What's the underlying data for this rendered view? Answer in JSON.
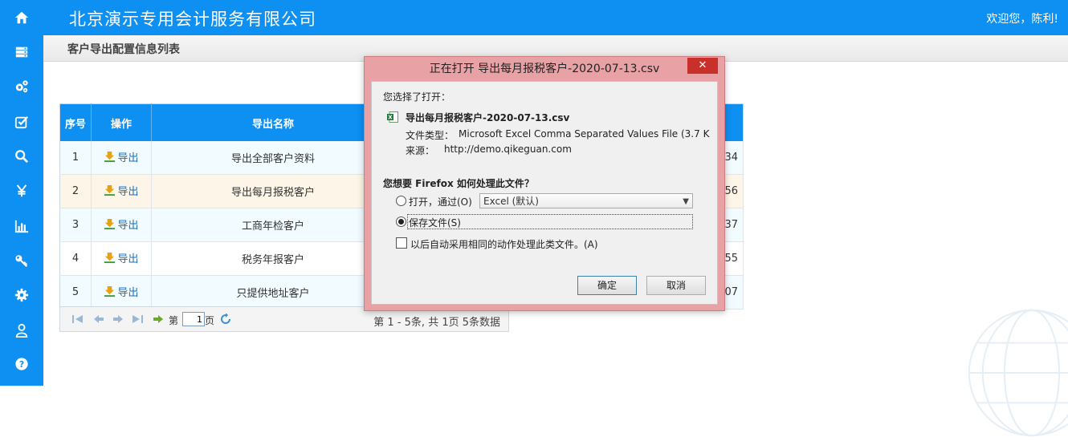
{
  "app": {
    "company_name": "北京演示专用会计服务有限公司",
    "welcome": "欢迎您，陈利!"
  },
  "sidebar": {
    "items": [
      {
        "icon": "home-icon"
      },
      {
        "icon": "server-icon"
      },
      {
        "icon": "gears-icon"
      },
      {
        "icon": "checkbox-icon"
      },
      {
        "icon": "search-icon"
      },
      {
        "icon": "yen-icon"
      },
      {
        "icon": "bar-chart-icon"
      },
      {
        "icon": "key-icon"
      },
      {
        "icon": "gear-icon"
      },
      {
        "icon": "user-icon"
      },
      {
        "icon": "help-icon"
      }
    ]
  },
  "page": {
    "title": "客户导出配置信息列表"
  },
  "table": {
    "headers": [
      "序号",
      "操作",
      "导出名称"
    ],
    "action_label": "导出",
    "rows": [
      {
        "no": "1",
        "name": "导出全部客户资料",
        "time_tail": ":34"
      },
      {
        "no": "2",
        "name": "导出每月报税客户",
        "time_tail": ":56"
      },
      {
        "no": "3",
        "name": "工商年检客户",
        "time_tail": ":37"
      },
      {
        "no": "4",
        "name": "税务年报客户",
        "time_tail": ":55"
      },
      {
        "no": "5",
        "name": "只提供地址客户",
        "time_tail": ":07"
      }
    ]
  },
  "pager": {
    "page_prefix": "第",
    "page_value": "1",
    "page_suffix": "页",
    "summary": "第 1 - 5条, 共 1页 5条数据"
  },
  "dialog": {
    "title": "正在打开 导出每月报税客户-2020-07-13.csv",
    "close_label": "✕",
    "you_chose": "您选择了打开：",
    "file_name": "导出每月报税客户-2020-07-13.csv",
    "file_type_label": "文件类型：",
    "file_type_value": "Microsoft Excel Comma Separated Values File (3.7 K",
    "source_label": "来源：",
    "source_value": "http://demo.qikeguan.com",
    "question": "您想要 Firefox 如何处理此文件？",
    "open_with_label": "打开，通过(O)",
    "open_with_value": "Excel (默认)",
    "save_label": "保存文件(S)",
    "auto_label": "以后自动采用相同的动作处理此类文件。(A)",
    "ok_label": "确定",
    "cancel_label": "取消",
    "selected_option": "save"
  }
}
